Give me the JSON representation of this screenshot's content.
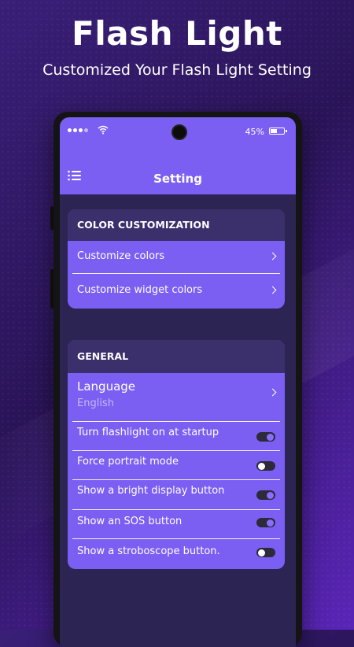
{
  "promo": {
    "title": "Flash Light",
    "subtitle": "Customized Your Flash Light Setting"
  },
  "status_bar": {
    "battery_percent": "45%",
    "battery_level": 0.45
  },
  "app_bar": {
    "menu_icon": "menu-list-icon",
    "title": "Setting"
  },
  "sections": {
    "color": {
      "header": "COLOR CUSTOMIZATION",
      "items": [
        {
          "label": "Customize colors",
          "icon": "chevron-right-icon"
        },
        {
          "label": "Customize widget colors",
          "icon": "chevron-right-icon"
        }
      ]
    },
    "general": {
      "header": "GENERAL",
      "language": {
        "label": "Language",
        "value": "English",
        "icon": "chevron-right-icon"
      },
      "toggles": [
        {
          "label": "Turn flashlight on at startup",
          "on": true
        },
        {
          "label": "Force portrait mode",
          "on": false
        },
        {
          "label": "Show a bright display button",
          "on": true
        },
        {
          "label": "Show an SOS button",
          "on": true
        },
        {
          "label": "Show a stroboscope button.",
          "on": false
        }
      ]
    }
  },
  "colors": {
    "accent": "#7b5ff2",
    "section_header": "#3b2f6c",
    "screen_background": "#2c2452",
    "toggle_track": "#2d2a3a",
    "toggle_knob_on": "#8a6cff"
  }
}
